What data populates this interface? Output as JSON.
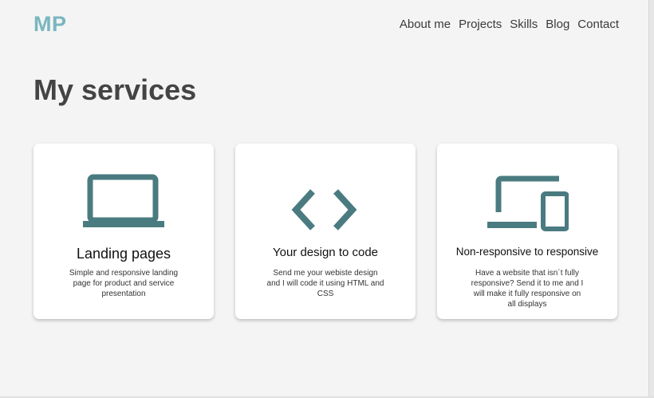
{
  "header": {
    "logo": "MP",
    "nav": [
      "About me",
      "Projects",
      "Skills",
      "Blog",
      "Contact"
    ]
  },
  "main": {
    "title": "My services",
    "services": [
      {
        "icon": "laptop-icon",
        "title": "Landing pages",
        "description": "Simple and responsive landing page for product and service presentation"
      },
      {
        "icon": "code-icon",
        "title": "Your design to code",
        "description": "Send me your webiste design and I will code it using HTML and CSS"
      },
      {
        "icon": "devices-icon",
        "title": "Non-responsive to responsive",
        "description": "Have a website that isn´t fully responsive? Send it to me and I will make it fully responsive on all displays"
      }
    ]
  },
  "colors": {
    "accent": "#7ab6c0",
    "icon": "#4a7b80",
    "title": "#444444",
    "background": "#f4f4f4",
    "card": "#ffffff"
  }
}
